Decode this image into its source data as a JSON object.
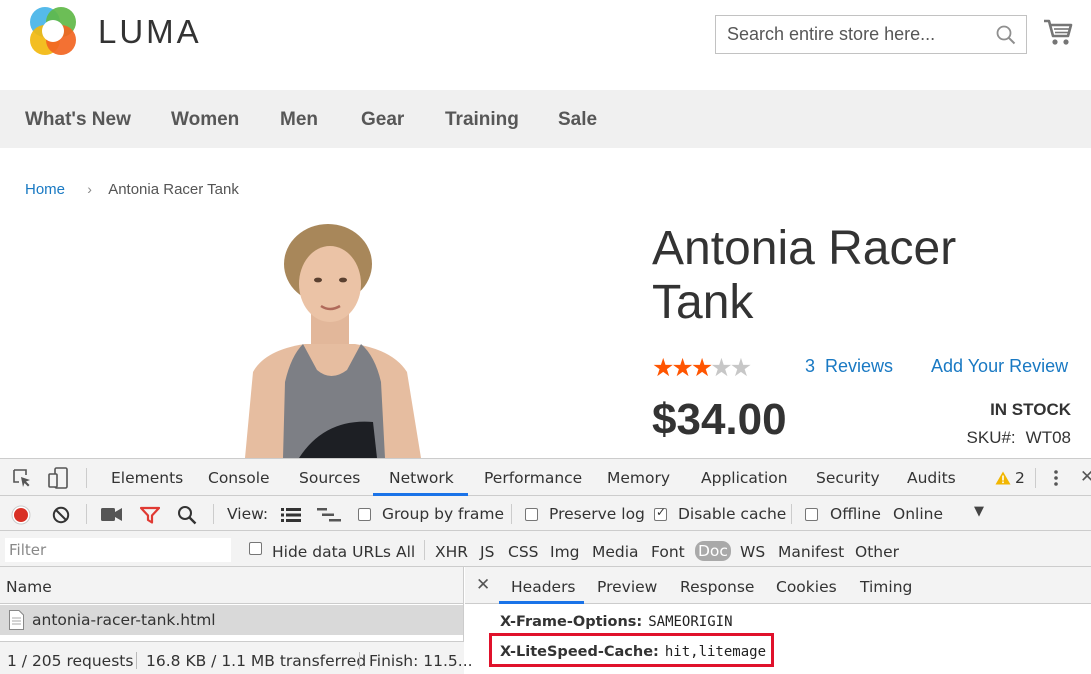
{
  "store": {
    "logo_text": "LUMA",
    "search_placeholder": "Search entire store here...",
    "nav": [
      "What's New",
      "Women",
      "Men",
      "Gear",
      "Training",
      "Sale"
    ],
    "breadcrumb": {
      "home": "Home",
      "current": "Antonia Racer Tank"
    }
  },
  "product": {
    "title": "Antonia Racer Tank",
    "rating": {
      "stars_filled": 3,
      "stars_total": 5
    },
    "reviews_count": "3",
    "reviews_label": "Reviews",
    "add_review": "Add Your Review",
    "price": "$34.00",
    "stock": "IN STOCK",
    "sku_label": "SKU#:",
    "sku_value": "WT08"
  },
  "devtools": {
    "tabs": [
      "Elements",
      "Console",
      "Sources",
      "Network",
      "Performance",
      "Memory",
      "Application",
      "Security",
      "Audits"
    ],
    "active_tab": "Network",
    "warning_count": "2",
    "toolbar": {
      "view_label": "View:",
      "group_by_frame": "Group by frame",
      "preserve_log": "Preserve log",
      "disable_cache": "Disable cache",
      "offline": "Offline",
      "throttle": "Online"
    },
    "filter": {
      "placeholder": "Filter",
      "hide_data_urls": "Hide data URLs",
      "types": [
        "All",
        "XHR",
        "JS",
        "CSS",
        "Img",
        "Media",
        "Font",
        "Doc",
        "WS",
        "Manifest",
        "Other"
      ],
      "selected_type": "Doc"
    },
    "requests": {
      "column_name": "Name",
      "rows": [
        "antonia-racer-tank.html"
      ],
      "status": {
        "requests": "1 / 205 requests",
        "transferred": "16.8 KB / 1.1 MB transferred",
        "finish": "Finish: 11.5..."
      }
    },
    "detail": {
      "tabs": [
        "Headers",
        "Preview",
        "Response",
        "Cookies",
        "Timing"
      ],
      "active_tab": "Headers",
      "headers": [
        {
          "key": "X-Frame-Options:",
          "value": "SAMEORIGIN"
        },
        {
          "key": "X-LiteSpeed-Cache:",
          "value": "hit,litemage"
        }
      ]
    },
    "colors": {
      "accent": "#1a73e8",
      "highlight": "#e0112b",
      "record": "#d93025"
    }
  }
}
